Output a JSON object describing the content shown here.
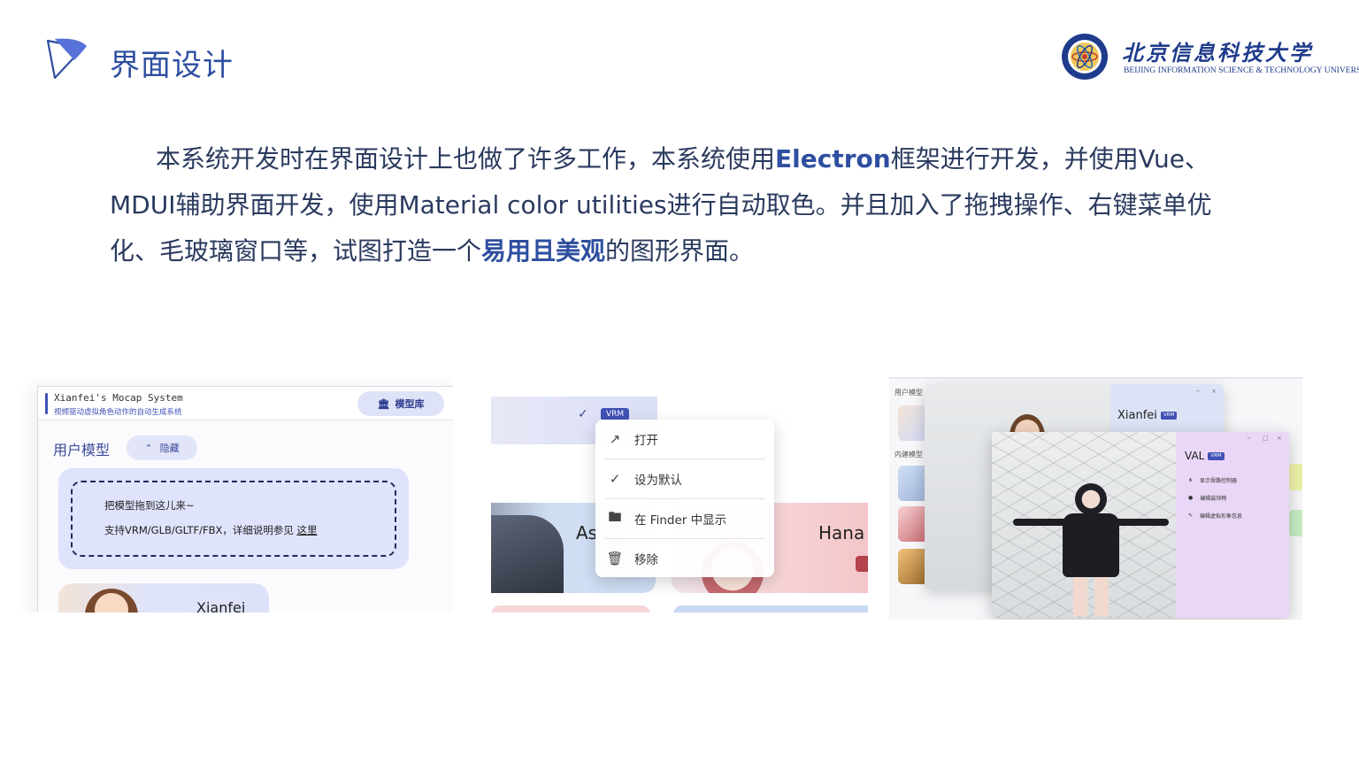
{
  "header": {
    "title": "界面设计",
    "university_cn": "北京信息科技大学",
    "university_en": "BEIJING INFORMATION SCIENCE & TECHNOLOGY UNIVERSITY"
  },
  "paragraph": {
    "p1": "本系统开发时在界面设计上也做了许多工作，本系统使用",
    "hl1": "Electron",
    "p2": "框架进行开发，并使用Vue、MDUI辅助界面开发，使用Material color utilities进行自动取色。并且加入了拖拽操作、右键菜单优化、毛玻璃窗口等，试图打造一个",
    "hl2": "易用且美观",
    "p3": "的图形界面。"
  },
  "shot1": {
    "app_name": "Xianfei's Mocap System",
    "app_subtitle": "视频驱动虚拟角色动作的自动生成系统",
    "library_button": "模型库",
    "section_title": "用户模型",
    "hide_button": "隐藏",
    "drop_line1": "把模型拖到这儿来~",
    "drop_line2": "支持VRM/GLB/GLTF/FBX，详细说明参见",
    "drop_link": "这里",
    "card_name": "Xianfei"
  },
  "shot2": {
    "tag": "VRM",
    "menu": [
      "打开",
      "设为默认",
      "在 Finder 中显示",
      "移除"
    ],
    "card_left": "As",
    "card_right": "Hana"
  },
  "shot3": {
    "label_user": "用户模型",
    "label_builtin": "内建模型",
    "win1_title": "Xianfei",
    "win2_title": "VAL",
    "tag": "VRM",
    "options": [
      "显示骨骼控制器",
      "编辑装饰物",
      "编辑虚拟形象信息"
    ]
  },
  "colors": {
    "accent": "#2e4fa0",
    "text": "#2a3a5e",
    "md_primary": "#3f51b5"
  }
}
